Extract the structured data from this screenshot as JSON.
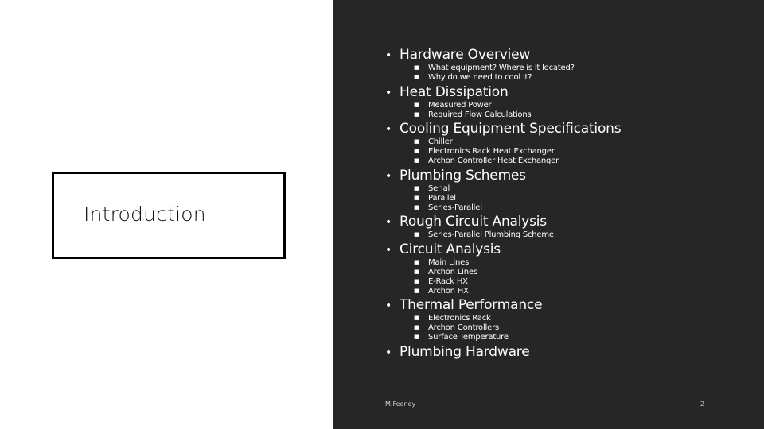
{
  "slide": {
    "title": "Introduction",
    "footer_author": "M.Feeney",
    "slide_number": "2",
    "colors": {
      "left_background": "#ffffff",
      "right_background": "#262626",
      "text_light": "#ffffff",
      "title_text": "#111111",
      "title_border": "#000000"
    }
  },
  "outline": [
    {
      "label": "Hardware Overview",
      "subitems": [
        "What equipment? Where is it located?",
        "Why do we need to cool it?"
      ]
    },
    {
      "label": "Heat Dissipation",
      "subitems": [
        "Measured Power",
        "Required Flow Calculations"
      ]
    },
    {
      "label": "Cooling Equipment Specifications",
      "subitems": [
        "Chiller",
        "Electronics Rack Heat Exchanger",
        "Archon Controller Heat Exchanger"
      ]
    },
    {
      "label": "Plumbing Schemes",
      "subitems": [
        "Serial",
        "Parallel",
        "Series-Parallel"
      ]
    },
    {
      "label": "Rough Circuit Analysis",
      "subitems": [
        "Series-Parallel Plumbing Scheme"
      ]
    },
    {
      "label": "Circuit Analysis",
      "subitems": [
        "Main Lines",
        "Archon Lines",
        "E-Rack HX",
        "Archon HX"
      ]
    },
    {
      "label": "Thermal Performance",
      "subitems": [
        "Electronics Rack",
        "Archon Controllers",
        "Surface Temperature"
      ]
    },
    {
      "label": "Plumbing Hardware",
      "subitems": []
    }
  ]
}
